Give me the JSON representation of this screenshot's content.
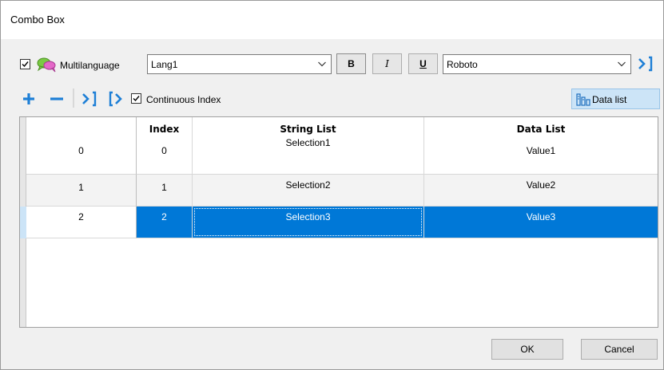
{
  "window": {
    "title": "Combo Box"
  },
  "toolbar": {
    "multilanguage": {
      "label": "Multilanguage",
      "checked": true
    },
    "language_combo": {
      "value": "Lang1"
    },
    "bold_label": "B",
    "italic_label": "I",
    "underline_label": "U",
    "font_combo": {
      "value": "Roboto"
    },
    "continuous_index": {
      "label": "Continuous Index",
      "checked": true
    },
    "data_list_button": "Data list"
  },
  "grid": {
    "columns": [
      "",
      "Index",
      "String List",
      "Data List"
    ],
    "rows": [
      {
        "row": "0",
        "index": "0",
        "string": "Selection1",
        "data": "Value1"
      },
      {
        "row": "1",
        "index": "1",
        "string": "Selection2",
        "data": "Value2"
      },
      {
        "row": "2",
        "index": "2",
        "string": "Selection3",
        "data": "Value3"
      }
    ],
    "selected_row": 2
  },
  "footer": {
    "ok_label": "OK",
    "cancel_label": "Cancel"
  },
  "colors": {
    "accent": "#0078d7",
    "add_icon": "#1e7fd6",
    "selection_bg": "#0078d7"
  }
}
